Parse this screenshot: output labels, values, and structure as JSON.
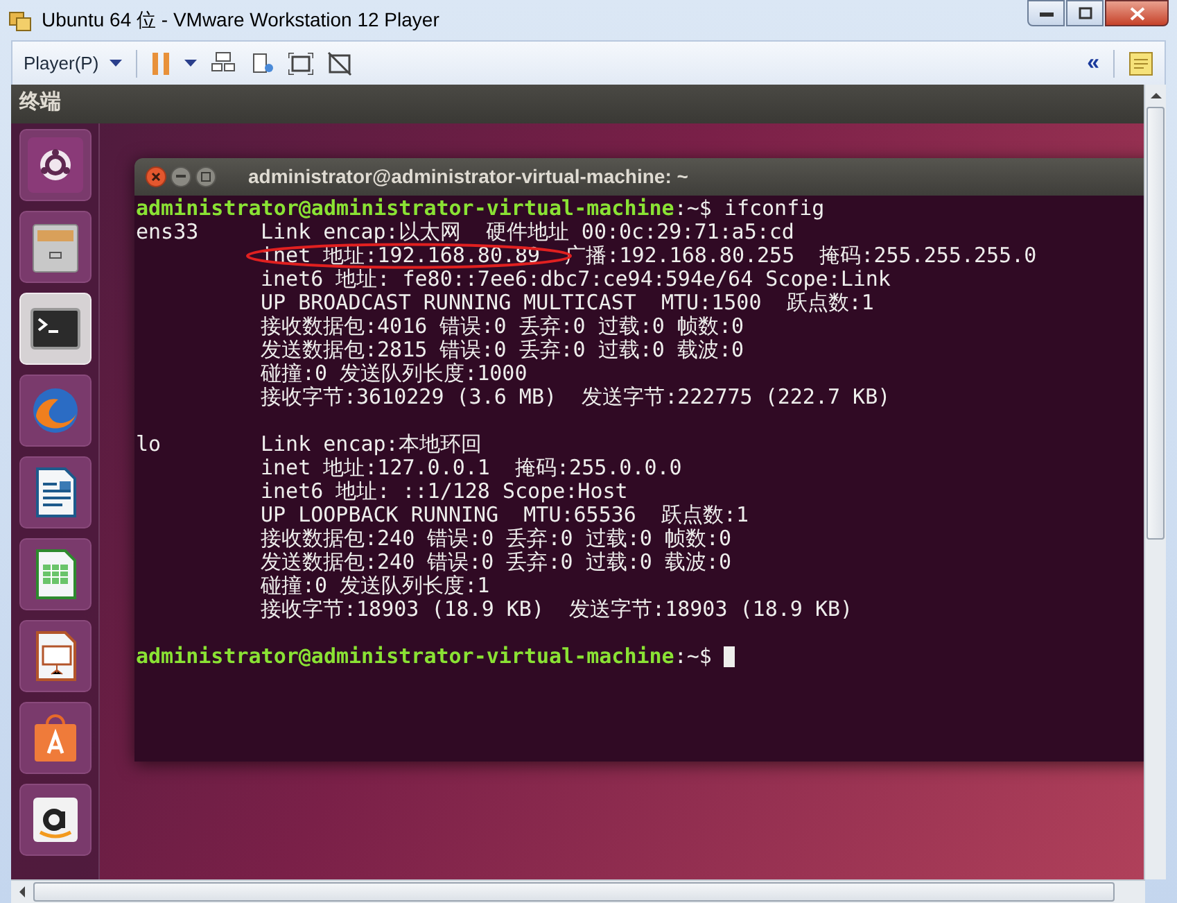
{
  "window": {
    "title": "Ubuntu 64 位 - VMware Workstation 12 Player"
  },
  "toolbar": {
    "player_menu": "Player(P)",
    "collapse": "«"
  },
  "top_panel": {
    "title": "终端"
  },
  "launcher": [
    {
      "kind": "dash",
      "selected": false
    },
    {
      "kind": "files",
      "selected": false
    },
    {
      "kind": "terminal",
      "selected": true
    },
    {
      "kind": "browser",
      "selected": false
    },
    {
      "kind": "writer",
      "selected": false
    },
    {
      "kind": "calc",
      "selected": false
    },
    {
      "kind": "impress",
      "selected": false
    },
    {
      "kind": "store",
      "selected": false
    },
    {
      "kind": "amazon",
      "selected": false
    }
  ],
  "terminal": {
    "title": "administrator@administrator-virtual-machine: ~",
    "lines": [
      {
        "kind": "prompt",
        "user": "administrator@administrator-virtual-machine",
        "path": ":~$",
        "command": "ifconfig"
      },
      {
        "kind": "output",
        "interface": "ens33",
        "text": "Link encap:以太网  硬件地址 00:0c:29:71:a5:cd"
      },
      {
        "kind": "output",
        "text": "inet 地址:192.168.80.89  广播:192.168.80.255  掩码:255.255.255.0",
        "circled": true
      },
      {
        "kind": "output",
        "text": "inet6 地址: fe80::7ee6:dbc7:ce94:594e/64 Scope:Link"
      },
      {
        "kind": "output",
        "text": "UP BROADCAST RUNNING MULTICAST  MTU:1500  跃点数:1"
      },
      {
        "kind": "output",
        "text": "接收数据包:4016 错误:0 丢弃:0 过载:0 帧数:0"
      },
      {
        "kind": "output",
        "text": "发送数据包:2815 错误:0 丢弃:0 过载:0 载波:0"
      },
      {
        "kind": "output",
        "text": "碰撞:0 发送队列长度:1000"
      },
      {
        "kind": "output",
        "text": "接收字节:3610229 (3.6 MB)  发送字节:222775 (222.7 KB)"
      },
      {
        "kind": "blank"
      },
      {
        "kind": "output",
        "interface": "lo",
        "text": "Link encap:本地环回"
      },
      {
        "kind": "output",
        "text": "inet 地址:127.0.0.1  掩码:255.0.0.0"
      },
      {
        "kind": "output",
        "text": "inet6 地址: ::1/128 Scope:Host"
      },
      {
        "kind": "output",
        "text": "UP LOOPBACK RUNNING  MTU:65536  跃点数:1"
      },
      {
        "kind": "output",
        "text": "接收数据包:240 错误:0 丢弃:0 过载:0 帧数:0"
      },
      {
        "kind": "output",
        "text": "发送数据包:240 错误:0 丢弃:0 过载:0 载波:0"
      },
      {
        "kind": "output",
        "text": "碰撞:0 发送队列长度:1"
      },
      {
        "kind": "output",
        "text": "接收字节:18903 (18.9 KB)  发送字节:18903 (18.9 KB)"
      },
      {
        "kind": "blank"
      },
      {
        "kind": "prompt",
        "user": "administrator@administrator-virtual-machine",
        "path": ":~$",
        "cursor": true
      }
    ]
  }
}
